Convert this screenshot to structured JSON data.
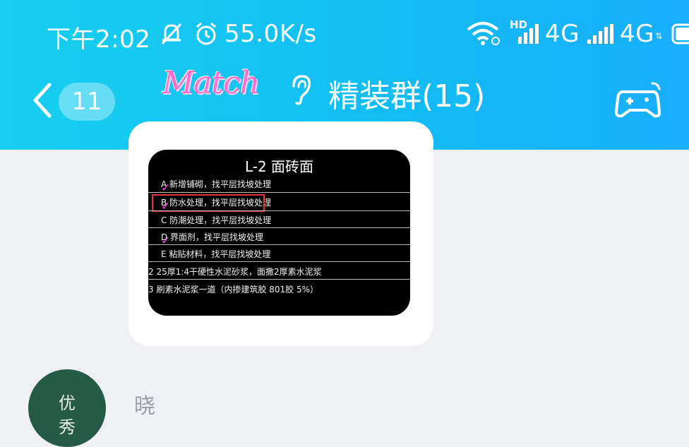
{
  "status_bar": {
    "time": "下午2:02",
    "speed": "55.0K/s",
    "net1": "4G",
    "net2": "4G",
    "hd": "HD"
  },
  "header": {
    "back_icon": "chevron-left-icon",
    "unread_count": "11",
    "logo_text": "Match",
    "ear_icon": "ear-icon",
    "title": "精装群(15)",
    "game_icon": "gamepad-icon"
  },
  "message": {
    "image": {
      "title": "L-2 面砖面",
      "lines": [
        "A  新增铺砌，找平层找坡处理",
        "B  防水处理，找平层找坡处理",
        "C  防潮处理，找平层找坡处理",
        "D  界面剂，找平层找坡处理",
        "E  粘贴材料，找平层找坡处理",
        "2  25厚1:4干硬性水泥砂浆，面撒2厚素水泥浆",
        "3  刷素水泥浆一道（内掺建筑胶 801胶 5%）"
      ]
    }
  },
  "next_message": {
    "avatar_text": [
      "优",
      "秀"
    ],
    "sender": "晓"
  }
}
